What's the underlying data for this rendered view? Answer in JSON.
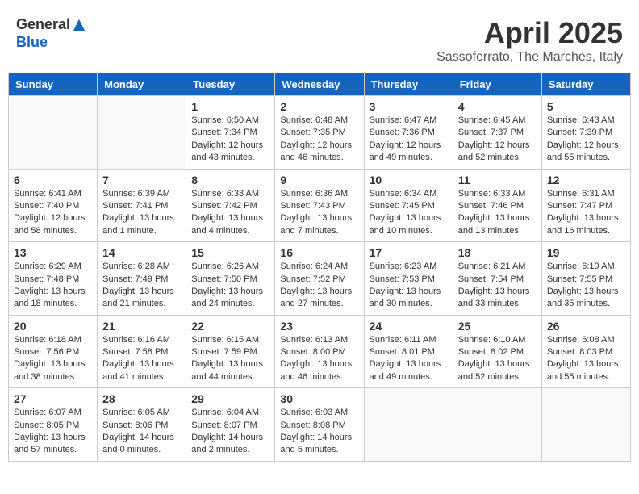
{
  "header": {
    "logo_line1": "General",
    "logo_line2": "Blue",
    "month_title": "April 2025",
    "subtitle": "Sassoferrato, The Marches, Italy"
  },
  "weekdays": [
    "Sunday",
    "Monday",
    "Tuesday",
    "Wednesday",
    "Thursday",
    "Friday",
    "Saturday"
  ],
  "weeks": [
    [
      {
        "day": "",
        "info": ""
      },
      {
        "day": "",
        "info": ""
      },
      {
        "day": "1",
        "info": "Sunrise: 6:50 AM\nSunset: 7:34 PM\nDaylight: 12 hours and 43 minutes."
      },
      {
        "day": "2",
        "info": "Sunrise: 6:48 AM\nSunset: 7:35 PM\nDaylight: 12 hours and 46 minutes."
      },
      {
        "day": "3",
        "info": "Sunrise: 6:47 AM\nSunset: 7:36 PM\nDaylight: 12 hours and 49 minutes."
      },
      {
        "day": "4",
        "info": "Sunrise: 6:45 AM\nSunset: 7:37 PM\nDaylight: 12 hours and 52 minutes."
      },
      {
        "day": "5",
        "info": "Sunrise: 6:43 AM\nSunset: 7:39 PM\nDaylight: 12 hours and 55 minutes."
      }
    ],
    [
      {
        "day": "6",
        "info": "Sunrise: 6:41 AM\nSunset: 7:40 PM\nDaylight: 12 hours and 58 minutes."
      },
      {
        "day": "7",
        "info": "Sunrise: 6:39 AM\nSunset: 7:41 PM\nDaylight: 13 hours and 1 minute."
      },
      {
        "day": "8",
        "info": "Sunrise: 6:38 AM\nSunset: 7:42 PM\nDaylight: 13 hours and 4 minutes."
      },
      {
        "day": "9",
        "info": "Sunrise: 6:36 AM\nSunset: 7:43 PM\nDaylight: 13 hours and 7 minutes."
      },
      {
        "day": "10",
        "info": "Sunrise: 6:34 AM\nSunset: 7:45 PM\nDaylight: 13 hours and 10 minutes."
      },
      {
        "day": "11",
        "info": "Sunrise: 6:33 AM\nSunset: 7:46 PM\nDaylight: 13 hours and 13 minutes."
      },
      {
        "day": "12",
        "info": "Sunrise: 6:31 AM\nSunset: 7:47 PM\nDaylight: 13 hours and 16 minutes."
      }
    ],
    [
      {
        "day": "13",
        "info": "Sunrise: 6:29 AM\nSunset: 7:48 PM\nDaylight: 13 hours and 18 minutes."
      },
      {
        "day": "14",
        "info": "Sunrise: 6:28 AM\nSunset: 7:49 PM\nDaylight: 13 hours and 21 minutes."
      },
      {
        "day": "15",
        "info": "Sunrise: 6:26 AM\nSunset: 7:50 PM\nDaylight: 13 hours and 24 minutes."
      },
      {
        "day": "16",
        "info": "Sunrise: 6:24 AM\nSunset: 7:52 PM\nDaylight: 13 hours and 27 minutes."
      },
      {
        "day": "17",
        "info": "Sunrise: 6:23 AM\nSunset: 7:53 PM\nDaylight: 13 hours and 30 minutes."
      },
      {
        "day": "18",
        "info": "Sunrise: 6:21 AM\nSunset: 7:54 PM\nDaylight: 13 hours and 33 minutes."
      },
      {
        "day": "19",
        "info": "Sunrise: 6:19 AM\nSunset: 7:55 PM\nDaylight: 13 hours and 35 minutes."
      }
    ],
    [
      {
        "day": "20",
        "info": "Sunrise: 6:18 AM\nSunset: 7:56 PM\nDaylight: 13 hours and 38 minutes."
      },
      {
        "day": "21",
        "info": "Sunrise: 6:16 AM\nSunset: 7:58 PM\nDaylight: 13 hours and 41 minutes."
      },
      {
        "day": "22",
        "info": "Sunrise: 6:15 AM\nSunset: 7:59 PM\nDaylight: 13 hours and 44 minutes."
      },
      {
        "day": "23",
        "info": "Sunrise: 6:13 AM\nSunset: 8:00 PM\nDaylight: 13 hours and 46 minutes."
      },
      {
        "day": "24",
        "info": "Sunrise: 6:11 AM\nSunset: 8:01 PM\nDaylight: 13 hours and 49 minutes."
      },
      {
        "day": "25",
        "info": "Sunrise: 6:10 AM\nSunset: 8:02 PM\nDaylight: 13 hours and 52 minutes."
      },
      {
        "day": "26",
        "info": "Sunrise: 6:08 AM\nSunset: 8:03 PM\nDaylight: 13 hours and 55 minutes."
      }
    ],
    [
      {
        "day": "27",
        "info": "Sunrise: 6:07 AM\nSunset: 8:05 PM\nDaylight: 13 hours and 57 minutes."
      },
      {
        "day": "28",
        "info": "Sunrise: 6:05 AM\nSunset: 8:06 PM\nDaylight: 14 hours and 0 minutes."
      },
      {
        "day": "29",
        "info": "Sunrise: 6:04 AM\nSunset: 8:07 PM\nDaylight: 14 hours and 2 minutes."
      },
      {
        "day": "30",
        "info": "Sunrise: 6:03 AM\nSunset: 8:08 PM\nDaylight: 14 hours and 5 minutes."
      },
      {
        "day": "",
        "info": ""
      },
      {
        "day": "",
        "info": ""
      },
      {
        "day": "",
        "info": ""
      }
    ]
  ]
}
